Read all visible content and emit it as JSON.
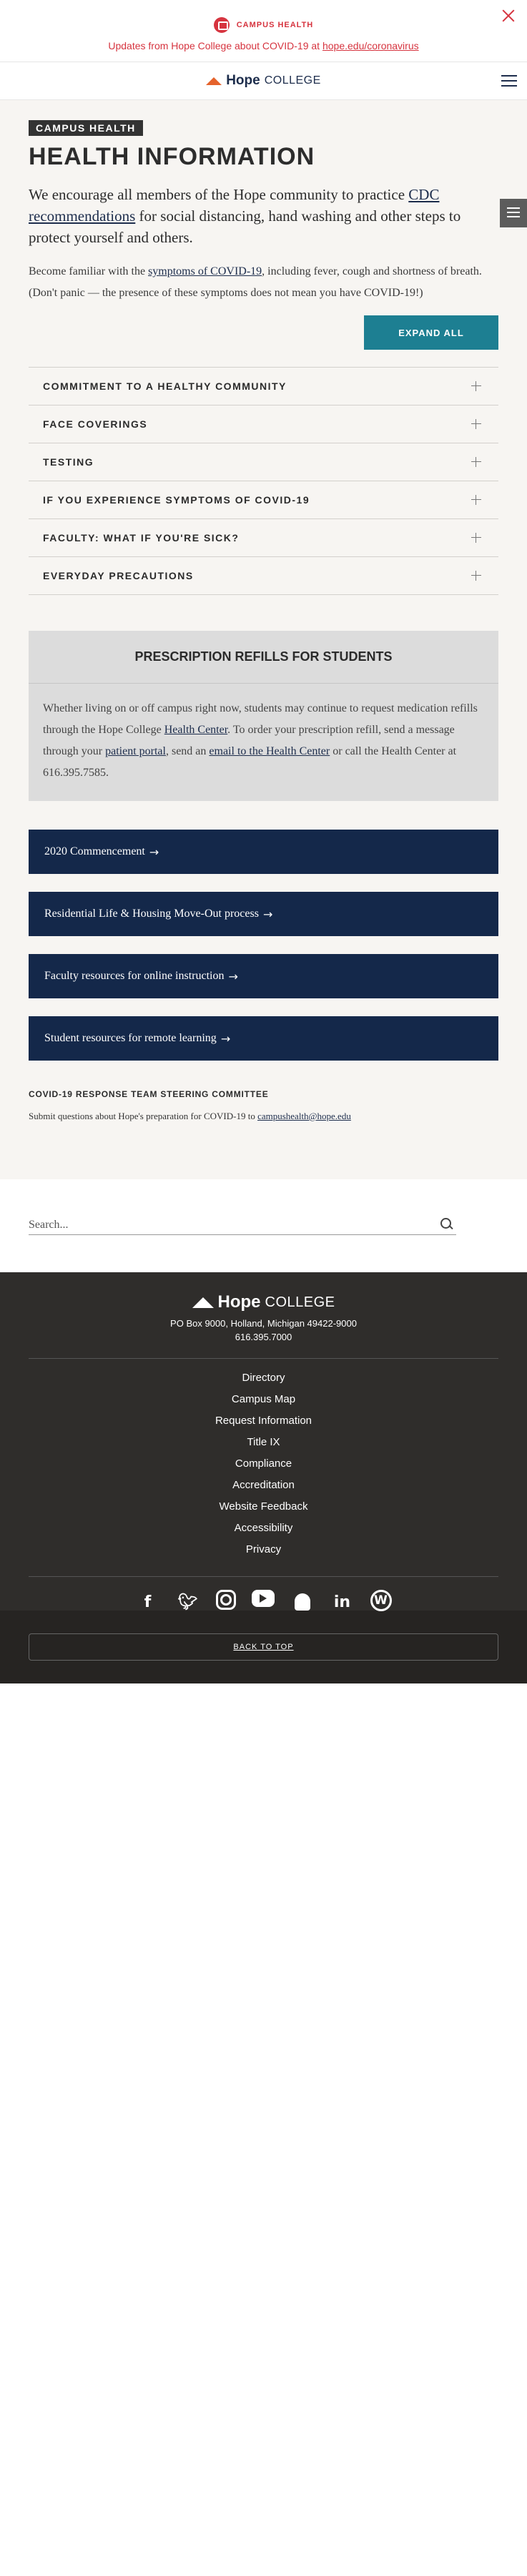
{
  "alert": {
    "title": "CAMPUS HEALTH",
    "message": "Updates from Hope College about COVID-19 at ",
    "link": "hope.edu/coronavirus"
  },
  "header": {
    "logo_hope": "Hope",
    "logo_college": "COLLEGE"
  },
  "main": {
    "badge": "CAMPUS HEALTH",
    "title": "HEALTH INFORMATION",
    "lead_pre": "We encourage all members of the Hope community to practice ",
    "lead_link": "CDC recommendations",
    "lead_post": " for social distancing, hand washing and other steps to protect yourself and others.",
    "para_pre": "Become familiar with the ",
    "para_link": "symptoms of COVID-19",
    "para_post": ", including fever, cough and shortness of breath. (Don't panic — the presence of these symptoms does not mean you have COVID-19!)",
    "expand_label": "EXPAND ALL",
    "accordion": [
      "COMMITMENT TO A HEALTHY COMMUNITY",
      "FACE COVERINGS",
      "TESTING",
      "IF YOU EXPERIENCE SYMPTOMS OF COVID-19",
      "FACULTY: WHAT IF YOU'RE SICK?",
      "EVERYDAY PRECAUTIONS"
    ],
    "rx": {
      "title": "PRESCRIPTION REFILLS FOR STUDENTS",
      "t1": "Whether living on or off campus right now, students may continue to request medication refills through the Hope College ",
      "l1": "Health Center",
      "t2": ". To order your prescription refill, send a message through your ",
      "l2": "patient portal",
      "t3": ", send an ",
      "l3": "email to the Health Center",
      "t4": " or call the Health Center at 616.395.7585."
    },
    "link_buttons": [
      "2020 Commencement",
      "Residential Life & Housing Move-Out process",
      "Faculty resources for online instruction",
      "Student resources for remote learning"
    ],
    "arrow_glyph": "→",
    "steering_title": "COVID-19 RESPONSE TEAM STEERING COMMITTEE",
    "steering_text": "Submit questions about Hope's preparation for COVID-19 to ",
    "steering_email": "campushealth@hope.edu"
  },
  "search": {
    "placeholder": "Search..."
  },
  "footer": {
    "logo_hope": "Hope",
    "logo_college": "COLLEGE",
    "address": "PO Box 9000, Holland, Michigan 49422-9000",
    "phone": "616.395.7000",
    "links": [
      "Directory",
      "Campus Map",
      "Request Information",
      "Title IX",
      "Compliance",
      "Accreditation",
      "Website Feedback",
      "Accessibility",
      "Privacy"
    ],
    "social_icons": [
      "facebook-icon",
      "twitter-icon",
      "instagram-icon",
      "youtube-icon",
      "snapchat-icon",
      "linkedin-icon",
      "wordpress-icon"
    ],
    "back_to_top": "BACK TO TOP"
  },
  "colors": {
    "alert_red": "#d6343f",
    "navy": "#14284a",
    "teal": "#1d7f92",
    "orange": "#e5632b",
    "footer_bg": "#2f2d2b"
  }
}
